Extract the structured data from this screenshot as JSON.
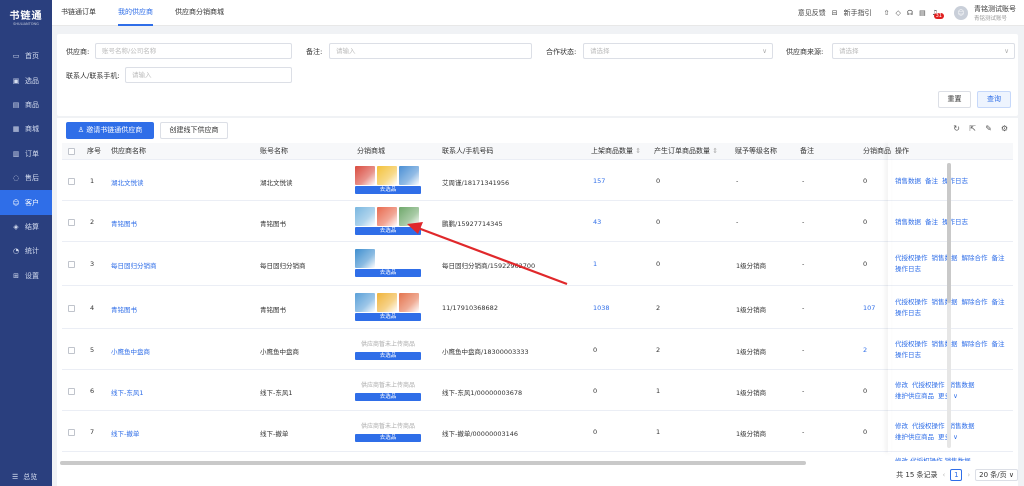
{
  "app": {
    "logo_main": "书链通",
    "logo_sub": "SHULIANTONG"
  },
  "sidebar": {
    "items": [
      {
        "label": "首页",
        "icon": "monitor-icon",
        "glyph": "▭"
      },
      {
        "label": "选品",
        "icon": "select-icon",
        "glyph": "▣"
      },
      {
        "label": "商品",
        "icon": "box-icon",
        "glyph": "▤"
      },
      {
        "label": "商城",
        "icon": "shop-icon",
        "glyph": "▦"
      },
      {
        "label": "订单",
        "icon": "order-icon",
        "glyph": "▥"
      },
      {
        "label": "售后",
        "icon": "headset-icon",
        "glyph": "◌"
      },
      {
        "label": "客户",
        "icon": "customer-icon",
        "glyph": "☺"
      },
      {
        "label": "结算",
        "icon": "settle-icon",
        "glyph": "◈"
      },
      {
        "label": "统计",
        "icon": "stats-icon",
        "glyph": "◔"
      },
      {
        "label": "设置",
        "icon": "settings-icon",
        "glyph": "⊞"
      }
    ],
    "active_index": 6,
    "footer": "总览"
  },
  "topbar": {
    "tabs": [
      "书链通订单",
      "我的供应商",
      "供应商分销商城"
    ],
    "active_tab": 1,
    "feedback": "意见反馈",
    "guide": "新手指引",
    "badge": "31",
    "user_name": "青铭测试账号",
    "user_role": "青铭测试账号"
  },
  "filters": {
    "supplier_label": "供应商:",
    "supplier_placeholder": "账号名称/公司名称",
    "remark_label": "备注:",
    "remark_placeholder": "请输入",
    "status_label": "合作状态:",
    "status_placeholder": "请选择",
    "source_label": "供应商来源:",
    "source_placeholder": "请选择",
    "contact_label": "联系人/联系手机:",
    "contact_placeholder": "请输入",
    "reset": "重置",
    "query": "查询"
  },
  "actions": {
    "invite": "邀请书链通供应商",
    "create_offline": "创建线下供应商"
  },
  "table": {
    "headers": [
      "序号",
      "供应商名称",
      "账号名称",
      "分销商城",
      "联系人/手机号码",
      "上架商品数量",
      "产生订单商品数量",
      "赋予等级名称",
      "备注",
      "分销商品",
      "操作"
    ],
    "goods_btn": "去选品",
    "no_goods": "供应商暂未上传商品",
    "rows": [
      {
        "idx": "1",
        "name": "湖北文悦读",
        "account": "湖北文悦读",
        "contact": "艾周谨/18171341956",
        "listed": "157",
        "ordered": "0",
        "level": "-",
        "remark": "-",
        "dist": "0",
        "goods": "img",
        "ops": [
          "销售数据",
          "备注",
          "操作日志"
        ]
      },
      {
        "idx": "2",
        "name": "青铭图书",
        "account": "青铭图书",
        "contact": "鹏鹏/15927714345",
        "listed": "43",
        "ordered": "0",
        "level": "-",
        "remark": "-",
        "dist": "0",
        "goods": "img",
        "ops": [
          "销售数据",
          "备注",
          "操作日志"
        ]
      },
      {
        "idx": "3",
        "name": "每日固归分销商",
        "account": "每日固归分销商",
        "contact": "每日固归分销商/15922962700",
        "listed": "1",
        "ordered": "0",
        "level": "1级分销商",
        "remark": "-",
        "dist": "0",
        "goods": "img1",
        "ops": [
          "代授权操作",
          "销售数据",
          "解除合作",
          "备注",
          "操作日志"
        ]
      },
      {
        "idx": "4",
        "name": "青铭图书",
        "account": "青铭图书",
        "contact": "11/17910368682",
        "listed": "1038",
        "ordered": "2",
        "level": "1级分销商",
        "remark": "-",
        "dist": "107",
        "goods": "img",
        "ops": [
          "代授权操作",
          "销售数据",
          "解除合作",
          "备注",
          "操作日志"
        ]
      },
      {
        "idx": "5",
        "name": "小鹰鱼中盘商",
        "account": "小鹰鱼中盘商",
        "contact": "小鹰鱼中盘商/18300003333",
        "listed": "0",
        "ordered": "2",
        "level": "1级分销商",
        "remark": "-",
        "dist": "2",
        "goods": "none",
        "ops": [
          "代授权操作",
          "销售数据",
          "解除合作",
          "备注",
          "操作日志"
        ]
      },
      {
        "idx": "6",
        "name": "线下-东风1",
        "account": "线下-东风1",
        "contact": "线下-东风1/00000003678",
        "listed": "0",
        "ordered": "1",
        "level": "1级分销商",
        "remark": "-",
        "dist": "0",
        "goods": "none",
        "ops": [
          "修改",
          "代授权操作",
          "销售数据",
          "维护供应商品",
          "更多 ∨"
        ]
      },
      {
        "idx": "7",
        "name": "线下-撤单",
        "account": "线下-撤单",
        "contact": "线下-撤单/00000003146",
        "listed": "0",
        "ordered": "1",
        "level": "1级分销商",
        "remark": "-",
        "dist": "0",
        "goods": "none",
        "ops": [
          "修改",
          "代授权操作",
          "销售数据",
          "维护供应商品",
          "更多 ∨"
        ]
      }
    ],
    "partial_ops": "修改 代授权操作 销售数据"
  },
  "pager": {
    "total": "共 15 条记录",
    "page": "1",
    "size": "20 条/页"
  },
  "colors": {
    "primary": "#2f6ee8",
    "sidebar": "#2a3f7e",
    "arrow": "#e0282b"
  }
}
